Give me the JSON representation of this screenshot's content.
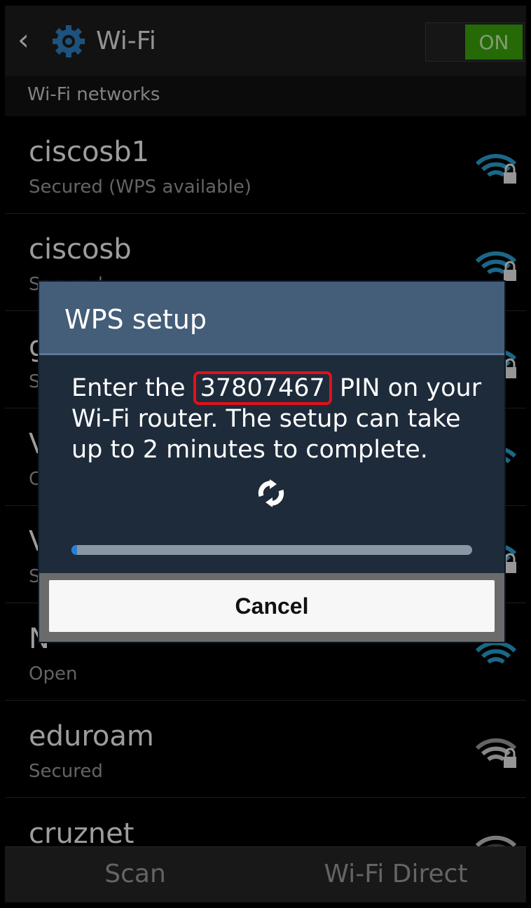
{
  "actionbar": {
    "back_icon": "chevron-left-icon",
    "settings_icon": "gear-icon",
    "title": "Wi-Fi",
    "toggle_label": "ON",
    "toggle_color": "#3aa40c"
  },
  "section_header": "Wi-Fi networks",
  "networks": [
    {
      "ssid": "ciscosb1",
      "status": "Secured (WPS available)",
      "icon": "wifi-locked-icon"
    },
    {
      "ssid": "ciscosb",
      "status": "Secured",
      "icon": "wifi-locked-icon"
    },
    {
      "ssid": "g",
      "status": "S",
      "icon": "wifi-locked-icon"
    },
    {
      "ssid": "V",
      "status": "C",
      "icon": "wifi-icon"
    },
    {
      "ssid": "V",
      "status": "S",
      "icon": "wifi-locked-icon"
    },
    {
      "ssid": "N",
      "status": "Open",
      "icon": "wifi-icon"
    },
    {
      "ssid": "eduroam",
      "status": "Secured",
      "icon": "wifi-locked-icon"
    },
    {
      "ssid": "cruznet",
      "status": "",
      "icon": "wifi-icon"
    }
  ],
  "bottombar": {
    "scan": "Scan",
    "wifi_direct": "Wi-Fi Direct"
  },
  "dialog": {
    "title": "WPS setup",
    "msg_prefix": "Enter the ",
    "pin": "37807467",
    "msg_suffix": " PIN on your Wi-Fi router. The setup can take up to 2 minutes to complete.",
    "spinner_icon": "sync-icon",
    "progress_fraction": 0.01,
    "cancel_label": "Cancel",
    "highlight_color": "#e3101a"
  }
}
